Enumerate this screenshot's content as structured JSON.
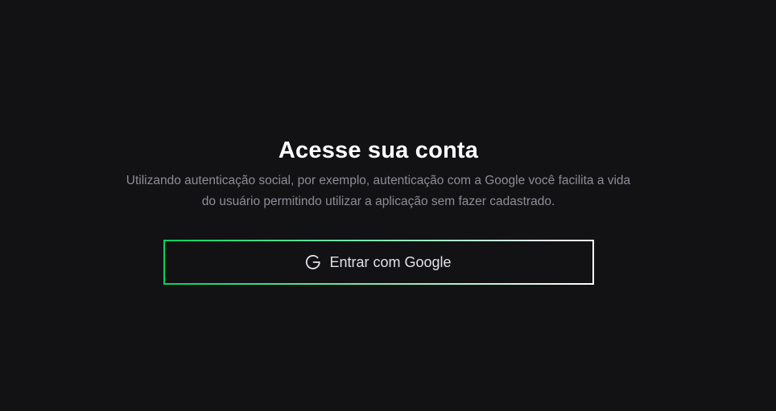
{
  "login": {
    "title": "Acesse sua conta",
    "description": "Utilizando autenticação social, por exemplo, autenticação com a Google você facilita a vida do usuário permitindo utilizar a aplicação sem fazer cadastrado.",
    "google_button": {
      "label": "Entrar com Google",
      "icon": "google-icon"
    }
  },
  "colors": {
    "background": "#121214",
    "title": "#ffffff",
    "description": "#8d8d99",
    "button_text": "#e1e1e6",
    "border_gradient_start": "#04d361",
    "border_gradient_end": "#ffffff"
  }
}
